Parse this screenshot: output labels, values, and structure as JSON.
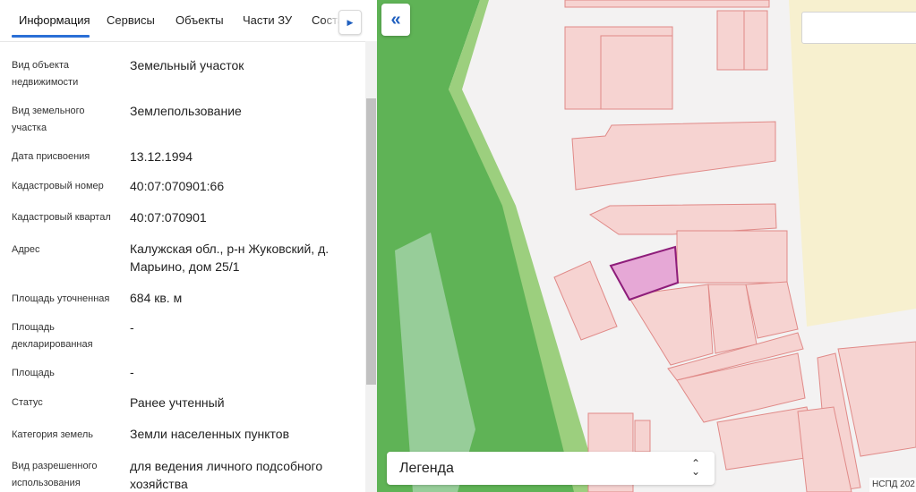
{
  "tabs": [
    {
      "label": "Информация",
      "active": true
    },
    {
      "label": "Сервисы",
      "active": false
    },
    {
      "label": "Объекты",
      "active": false
    },
    {
      "label": "Части ЗУ",
      "active": false
    },
    {
      "label": "Состав",
      "active": false
    }
  ],
  "info": {
    "object_type": {
      "label": "Вид объекта недвижимости",
      "value": "Земельный участок"
    },
    "land_plot_type": {
      "label": "Вид земельного участка",
      "value": "Землепользование"
    },
    "assignment_date": {
      "label": "Дата присвоения",
      "value": "13.12.1994"
    },
    "cadastral_number": {
      "label": "Кадастровый номер",
      "value": "40:07:070901:66"
    },
    "cadastral_quarter": {
      "label": "Кадастровый квартал",
      "value": "40:07:070901"
    },
    "address": {
      "label": "Адрес",
      "value": "Калужская обл., р-н Жуковский, д. Марьино, дом 25/1"
    },
    "area_specified": {
      "label": "Площадь уточненная",
      "value": "684 кв. м"
    },
    "area_declared": {
      "label": "Площадь декларированная",
      "value": "-"
    },
    "area": {
      "label": "Площадь",
      "value": "-"
    },
    "status": {
      "label": "Статус",
      "value": "Ранее учтенный"
    },
    "land_category": {
      "label": "Категория земель",
      "value": "Земли населенных пунктов"
    },
    "permitted_use": {
      "label": "Вид разрешенного использования",
      "value": "для ведения личного подсобного хозяйства"
    }
  },
  "map": {
    "legend_label": "Легенда",
    "attribution": "НСПД 202",
    "icons": {
      "collapse": "double-chevron-left-icon",
      "legend_toggle": "chevron-up-down-icon",
      "tabs_next": "triangle-right-icon"
    },
    "colors": {
      "parcel_fill": "#f6d3d1",
      "parcel_stroke": "#e08a88",
      "forest": "#5fb356",
      "selected_fill": "#e6a8d6",
      "selected_stroke": "#8e1d7a",
      "field": "#f7f0cf"
    }
  },
  "colors": {
    "accent": "#2a6fd6"
  }
}
